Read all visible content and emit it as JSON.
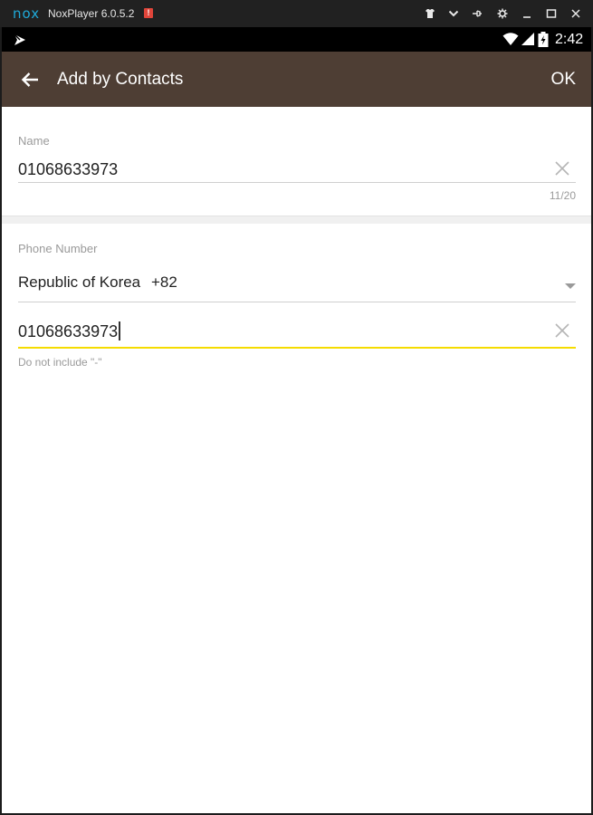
{
  "emulator": {
    "logo": "nox",
    "title": "NoxPlayer 6.0.5.2",
    "alert_badge": "!",
    "controls": [
      "shirt-icon",
      "chevron-down-icon",
      "pin-icon",
      "gear-icon",
      "minimize-icon",
      "maximize-icon",
      "close-icon"
    ]
  },
  "status_bar": {
    "time": "2:42"
  },
  "app_bar": {
    "title": "Add by Contacts",
    "ok_label": "OK"
  },
  "name_field": {
    "label": "Name",
    "value": "01068633973",
    "counter": "11/20"
  },
  "phone_section": {
    "label": "Phone Number",
    "country": "Republic of Korea",
    "country_code": "+82",
    "phone_value": "01068633973",
    "hint": "Do not include \"-\""
  },
  "colors": {
    "app_bar": "#4e3e34",
    "focus_underline": "#f5dc00"
  }
}
